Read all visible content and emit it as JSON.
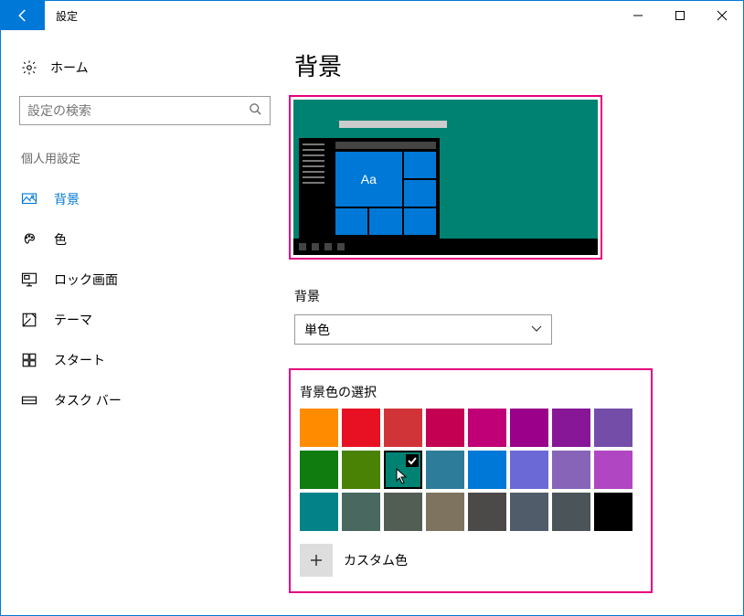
{
  "window": {
    "title": "設定"
  },
  "sidebar": {
    "home": "ホーム",
    "search_placeholder": "設定の検索",
    "section": "個人用設定",
    "items": [
      {
        "label": "背景",
        "active": true
      },
      {
        "label": "色"
      },
      {
        "label": "ロック画面"
      },
      {
        "label": "テーマ"
      },
      {
        "label": "スタート"
      },
      {
        "label": "タスク バー"
      }
    ]
  },
  "page": {
    "title": "背景",
    "preview": {
      "bg_color": "#008272",
      "tile_text": "Aa"
    },
    "dropdown_label": "背景",
    "dropdown_value": "単色",
    "colorpicker_label": "背景色の選択",
    "colors": [
      "#FF8C00",
      "#E81123",
      "#D13438",
      "#C30052",
      "#BF0077",
      "#9A0089",
      "#881798",
      "#744DA9",
      "#107C10",
      "#498205",
      "#008272",
      "#2D7D9A",
      "#0078D7",
      "#6B69D6",
      "#8764B8",
      "#B146C2",
      "#038387",
      "#486860",
      "#525E54",
      "#7E735F",
      "#4C4A48",
      "#515C6B",
      "#4A5459",
      "#000000"
    ],
    "selected_color_index": 10,
    "custom_label": "カスタム色"
  }
}
